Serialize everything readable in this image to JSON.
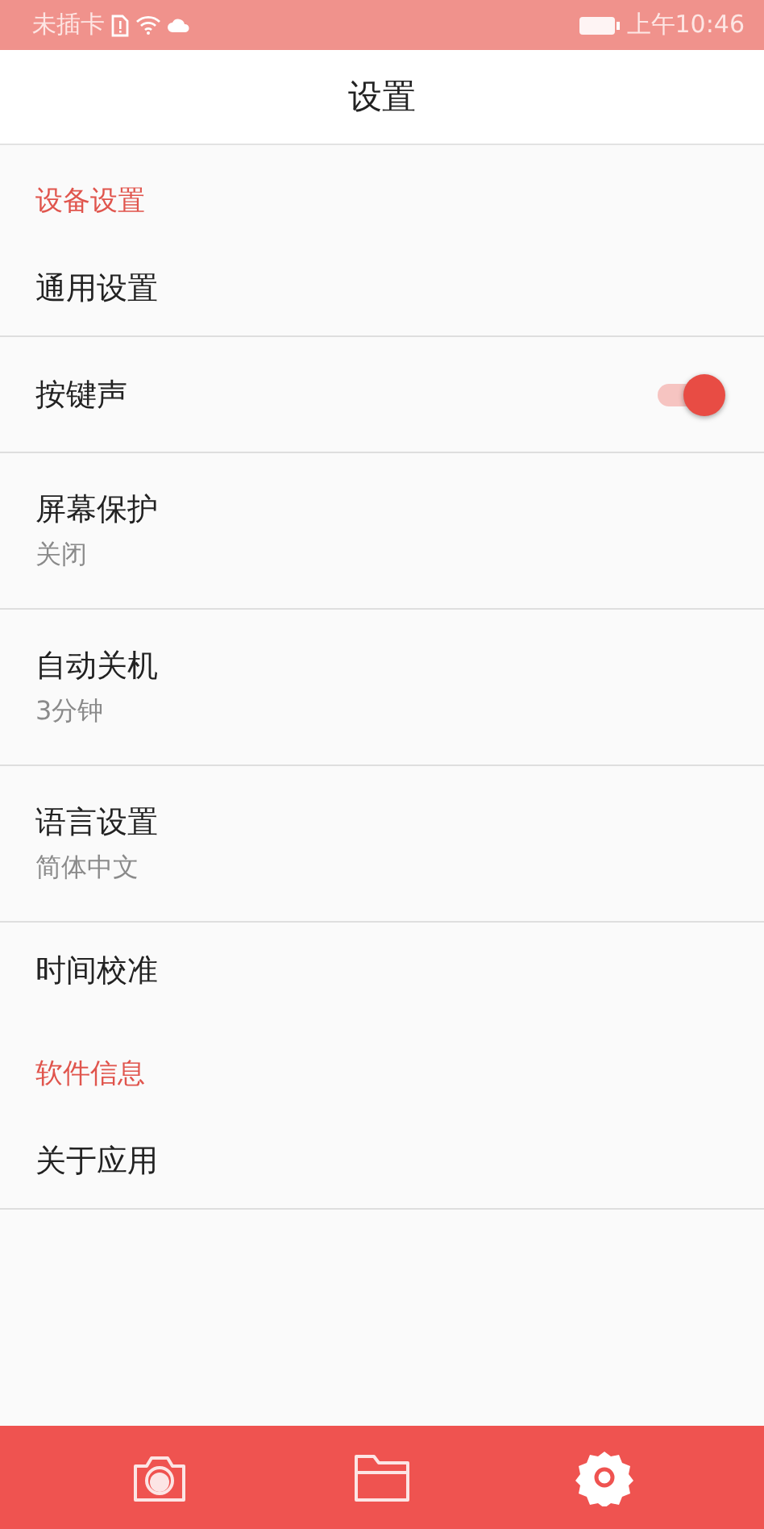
{
  "status_bar": {
    "carrier": "未插卡",
    "time": "上午10:46"
  },
  "header": {
    "title": "设置"
  },
  "sections": [
    {
      "title": "设备设置",
      "items": [
        {
          "kind": "plain",
          "label": "通用设置"
        },
        {
          "kind": "toggle",
          "label": "按键声",
          "on": true
        },
        {
          "kind": "value",
          "label": "屏幕保护",
          "value": "关闭"
        },
        {
          "kind": "value",
          "label": "自动关机",
          "value": "3分钟"
        },
        {
          "kind": "value",
          "label": "语言设置",
          "value": "简体中文"
        },
        {
          "kind": "plain",
          "label": "时间校准"
        }
      ]
    },
    {
      "title": "软件信息",
      "items": [
        {
          "kind": "plain",
          "label": "关于应用"
        }
      ]
    }
  ],
  "bottom_nav": [
    {
      "kind": "camera",
      "selected": false
    },
    {
      "kind": "folder",
      "selected": false
    },
    {
      "kind": "settings",
      "selected": true
    }
  ]
}
